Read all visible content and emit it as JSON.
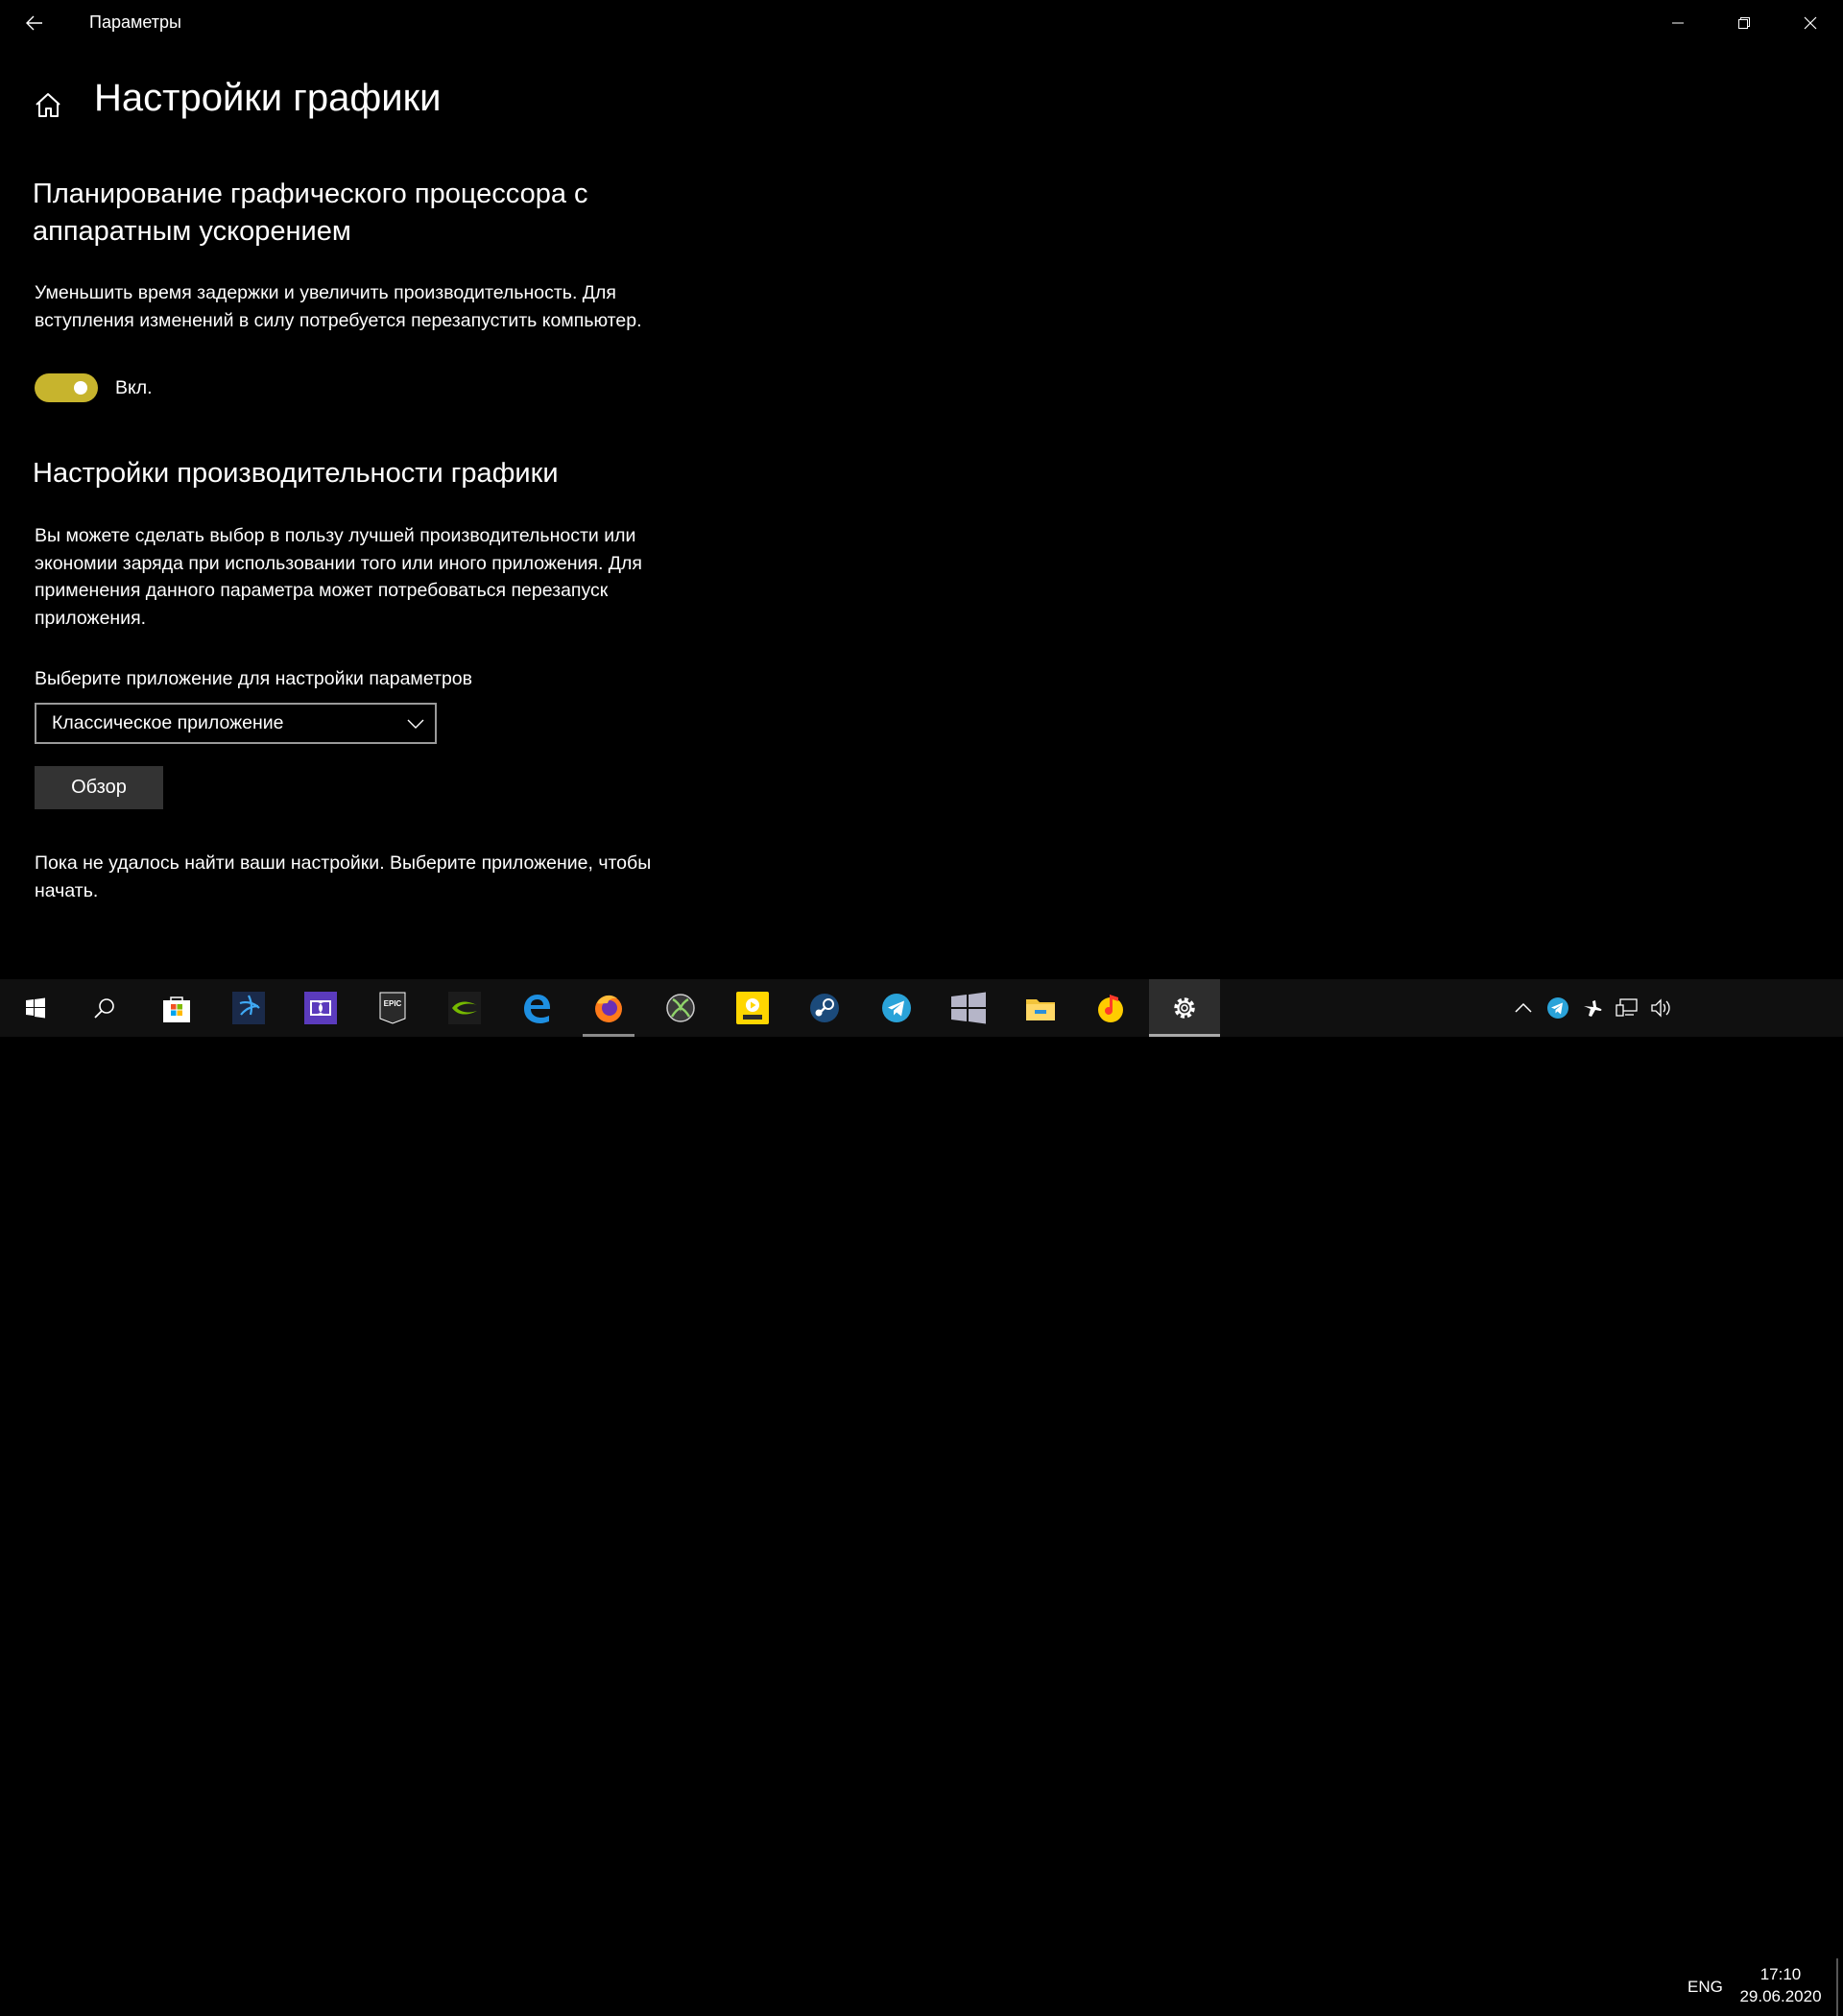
{
  "window": {
    "title": "Параметры"
  },
  "page": {
    "title": "Настройки графики"
  },
  "hw_scheduling": {
    "title": "Планирование графического процессора с аппаратным ускорением",
    "description": "Уменьшить время задержки и увеличить производительность. Для вступления изменений в силу потребуется перезапустить компьютер.",
    "toggle_state": "Вкл.",
    "toggle_on": true,
    "accent_color": "#c7b42d"
  },
  "perf": {
    "title": "Настройки производительности графики",
    "description": "Вы можете сделать выбор в пользу лучшей производительности или экономии заряда при использовании того или иного приложения. Для применения данного параметра может потребоваться перезапуск приложения.",
    "select_label": "Выберите приложение для настройки параметров",
    "app_type_selected": "Классическое приложение",
    "browse_label": "Обзор",
    "status_message": "Пока не удалось найти ваши настройки. Выберите приложение, чтобы начать."
  },
  "taskbar": {
    "apps": [
      {
        "icon": "windows-start-icon"
      },
      {
        "icon": "search-icon"
      },
      {
        "icon": "microsoft-store-icon"
      },
      {
        "icon": "battlenet-icon"
      },
      {
        "icon": "dolby-access-icon"
      },
      {
        "icon": "epic-games-icon"
      },
      {
        "icon": "nvidia-icon"
      },
      {
        "icon": "edge-icon"
      },
      {
        "icon": "firefox-icon"
      },
      {
        "icon": "xbox-icon"
      },
      {
        "icon": "player-icon"
      },
      {
        "icon": "steam-icon"
      },
      {
        "icon": "telegram-icon"
      },
      {
        "icon": "windows-icon"
      },
      {
        "icon": "file-explorer-icon"
      },
      {
        "icon": "yandex-music-icon"
      },
      {
        "icon": "settings-gear-icon"
      }
    ],
    "language": "ENG",
    "time": "17:10",
    "date": "29.06.2020"
  }
}
